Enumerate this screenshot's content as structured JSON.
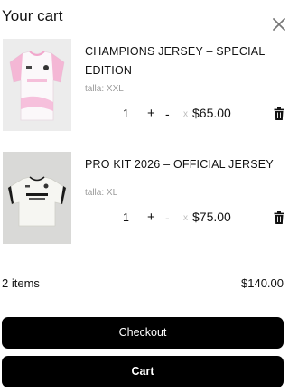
{
  "header": {
    "title": "Your cart",
    "close_icon": "close-icon"
  },
  "items": [
    {
      "name": "CHAMPIONS JERSEY – SPECIAL EDITION",
      "variant": "talla: XXL",
      "quantity": "1",
      "plus": "+",
      "minus": "-",
      "times": "x",
      "price": "$65.00",
      "image": "pink-white-jersey",
      "delete_icon": "trash-icon"
    },
    {
      "name": "PRO KIT 2026 – OFFICIAL JERSEY",
      "variant": "talla: XL",
      "quantity": "1",
      "plus": "+",
      "minus": "-",
      "times": "x",
      "price": "$75.00",
      "image": "white-kit-jersey",
      "delete_icon": "trash-icon"
    }
  ],
  "summary": {
    "count": "2 items",
    "total": "$140.00"
  },
  "buttons": {
    "checkout": "Checkout",
    "cart": "Cart"
  },
  "colors": {
    "button_bg": "#000000",
    "button_text": "#ffffff",
    "muted_text": "#9a9a9a",
    "jersey_accent": "#f2a6cc"
  }
}
